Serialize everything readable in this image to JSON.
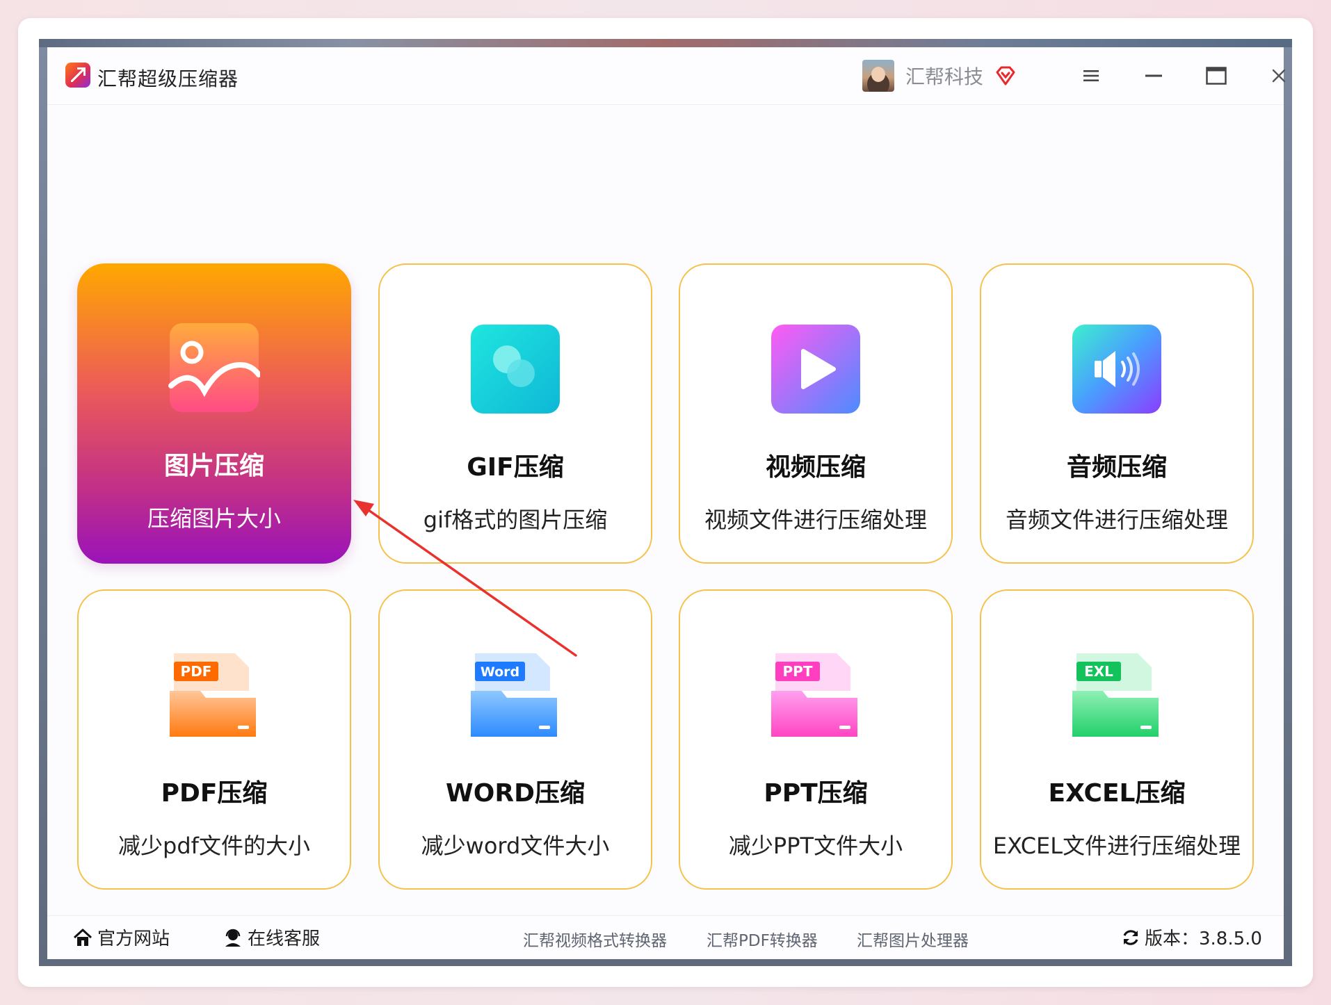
{
  "window": {
    "title": "汇帮超级压缩器",
    "user_name": "汇帮科技"
  },
  "cards": [
    {
      "title": "图片压缩",
      "subtitle": "压缩图片大小",
      "active": true
    },
    {
      "title": "GIF压缩",
      "subtitle": "gif格式的图片压缩"
    },
    {
      "title": "视频压缩",
      "subtitle": "视频文件进行压缩处理"
    },
    {
      "title": "音频压缩",
      "subtitle": "音频文件进行压缩处理"
    },
    {
      "title": "PDF压缩",
      "subtitle": "减少pdf文件的大小",
      "badge": "PDF"
    },
    {
      "title": "WORD压缩",
      "subtitle": "减少word文件大小",
      "badge": "Word"
    },
    {
      "title": "PPT压缩",
      "subtitle": "减少PPT文件大小",
      "badge": "PPT"
    },
    {
      "title": "EXCEL压缩",
      "subtitle": "EXCEL文件进行压缩处理",
      "badge": "EXL"
    }
  ],
  "footer": {
    "official_site": "官方网站",
    "online_service": "在线客服",
    "products": [
      "汇帮视频格式转换器",
      "汇帮PDF转换器",
      "汇帮图片处理器"
    ],
    "version": "版本：3.8.5.0"
  },
  "colors": {
    "card_border": "#f6c14b",
    "active_gradient_top": "#ffa800",
    "active_gradient_bottom": "#9a13b9",
    "annotation_arrow": "#e8322d"
  }
}
